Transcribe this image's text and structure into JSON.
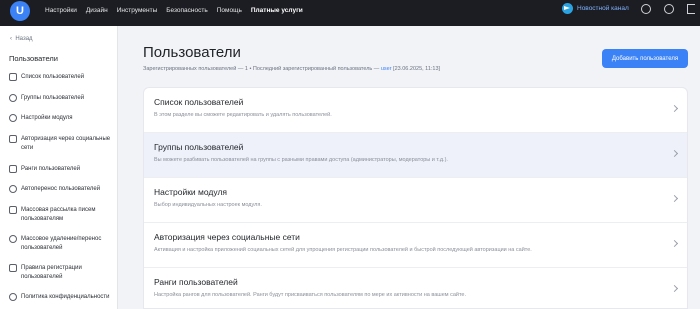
{
  "topbar": {
    "logo_letter": "U",
    "nav": [
      "Настройки",
      "Дизайн",
      "Инструменты",
      "Безопасность",
      "Помощь",
      "Платные услуги"
    ],
    "news_label": "Новостной канал"
  },
  "sidebar": {
    "back_label": "Назад",
    "title": "Пользователи",
    "items": [
      {
        "label": "Список пользователей",
        "icon": "user-list-icon"
      },
      {
        "label": "Группы пользователей",
        "icon": "users-group-icon"
      },
      {
        "label": "Настройки модуля",
        "icon": "gear-icon"
      },
      {
        "label": "Авторизация через социальные сети",
        "icon": "lock-icon"
      },
      {
        "label": "Ранги пользователей",
        "icon": "crown-icon"
      },
      {
        "label": "Автоперенос пользователей",
        "icon": "transfer-icon"
      },
      {
        "label": "Массовая рассылка писем пользователям",
        "icon": "mail-icon"
      },
      {
        "label": "Массовое удаление/перенос пользователей",
        "icon": "user-delete-icon"
      },
      {
        "label": "Правила регистрации пользователей",
        "icon": "document-icon"
      },
      {
        "label": "Политика конфиденциальности",
        "icon": "shield-icon"
      }
    ]
  },
  "main": {
    "title": "Пользователи",
    "subtitle_prefix": "Зарегистрированных пользователей — 1 • Последний зарегистрированный пользователь — ",
    "subtitle_link": "user",
    "subtitle_suffix": " [23.06.2025, 11:13]",
    "add_button": "Добавить пользователя",
    "rows": [
      {
        "title": "Список пользователей",
        "desc": "В этом разделе вы сможете редактировать и удалять пользователей."
      },
      {
        "title": "Группы пользователей",
        "desc": "Вы можете разбивать пользователей на группы с разными правами доступа (администраторы, модераторы и т.д.)."
      },
      {
        "title": "Настройки модуля",
        "desc": "Выбор индивидуальных настроек модуля."
      },
      {
        "title": "Авторизация через социальные сети",
        "desc": "Активация и настройка приложений социальных сетей для упрощения регистрации пользователей и быстрой последующей авторизации на сайте."
      },
      {
        "title": "Ранги пользователей",
        "desc": "Настройка рангов для пользователей. Ранги будут присваиваться пользователям по мере их активности на вашем сайте."
      }
    ]
  },
  "colors": {
    "accent": "#3b82f6",
    "topbar_bg": "#1c1d22",
    "active_row": "#eef1fa"
  }
}
